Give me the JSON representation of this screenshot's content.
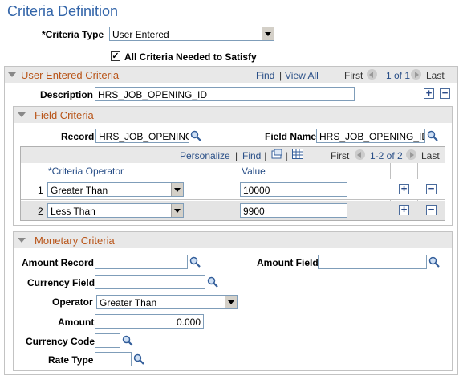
{
  "page": {
    "title": "Criteria Definition"
  },
  "criteria_type": {
    "label": "*Criteria Type",
    "value": "User Entered"
  },
  "all_needed": {
    "label": "All Criteria Needed to Satisfy",
    "checked": true
  },
  "user_entered": {
    "header": "User Entered Criteria",
    "find": "Find",
    "sep": "|",
    "view_all": "View All",
    "first": "First",
    "count": "1 of 1",
    "last": "Last",
    "description_label": "Description",
    "description_value": "HRS_JOB_OPENING_ID"
  },
  "field_criteria": {
    "header": "Field Criteria",
    "record_label": "Record",
    "record_value": "HRS_JOB_OPENING",
    "field_name_label": "Field Name",
    "field_name_value": "HRS_JOB_OPENING_ID",
    "personalize": "Personalize",
    "sep": "|",
    "find": "Find",
    "first": "First",
    "count": "1-2 of 2",
    "last": "Last",
    "col_operator": "*Criteria Operator",
    "col_value": "Value",
    "rows": [
      {
        "num": "1",
        "operator": "Greater Than",
        "value": "10000"
      },
      {
        "num": "2",
        "operator": "Less Than",
        "value": "9900"
      }
    ]
  },
  "monetary": {
    "header": "Monetary Criteria",
    "amount_record_label": "Amount Record",
    "amount_record_value": "",
    "amount_field_label": "Amount Field",
    "amount_field_value": "",
    "currency_field_label": "Currency Field",
    "currency_field_value": "",
    "operator_label": "Operator",
    "operator_value": "Greater Than",
    "amount_label": "Amount",
    "amount_value": "0.000",
    "currency_code_label": "Currency Code",
    "currency_code_value": "",
    "rate_type_label": "Rate Type",
    "rate_type_value": ""
  }
}
